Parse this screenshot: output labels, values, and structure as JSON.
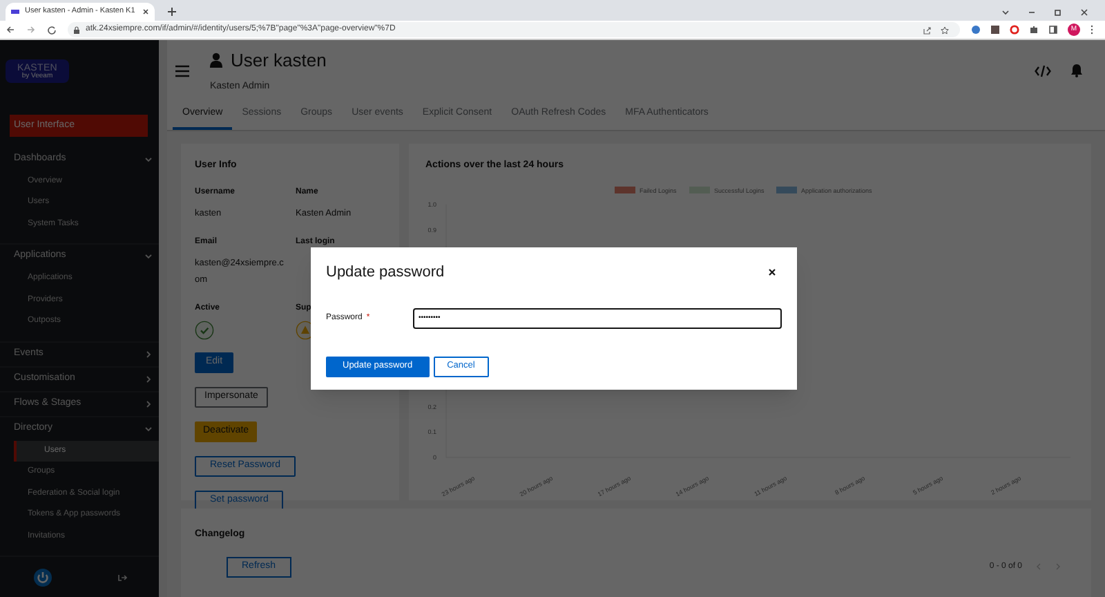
{
  "browser": {
    "tab_title": "User kasten - Admin - Kasten K1",
    "url": "atk.24xsiempre.com/if/admin/#/identity/users/5;%7B\"page\"%3A\"page-overview\"%7D",
    "profile_initial": "M"
  },
  "sidebar": {
    "logo": {
      "name": "KASTEN",
      "tagline": "by Veeam"
    },
    "interface_link": "User Interface",
    "sections": [
      {
        "label": "Dashboards",
        "expanded": true,
        "items": [
          {
            "label": "Overview",
            "selected": false
          },
          {
            "label": "Users",
            "selected": false
          },
          {
            "label": "System Tasks",
            "selected": false
          }
        ]
      },
      {
        "label": "Applications",
        "expanded": true,
        "items": [
          {
            "label": "Applications",
            "selected": false
          },
          {
            "label": "Providers",
            "selected": false
          },
          {
            "label": "Outposts",
            "selected": false
          }
        ]
      },
      {
        "label": "Events",
        "expanded": false
      },
      {
        "label": "Customisation",
        "expanded": false
      },
      {
        "label": "Flows & Stages",
        "expanded": false
      },
      {
        "label": "Directory",
        "expanded": true,
        "items": [
          {
            "label": "Users",
            "selected": true
          },
          {
            "label": "Groups",
            "selected": false
          },
          {
            "label": "Federation & Social login",
            "selected": false
          },
          {
            "label": "Tokens & App passwords",
            "selected": false
          },
          {
            "label": "Invitations",
            "selected": false
          }
        ]
      }
    ]
  },
  "header": {
    "title": "User kasten",
    "subtitle": "Kasten Admin"
  },
  "tabs": [
    {
      "label": "Overview",
      "selected": true
    },
    {
      "label": "Sessions",
      "selected": false
    },
    {
      "label": "Groups",
      "selected": false
    },
    {
      "label": "User events",
      "selected": false
    },
    {
      "label": "Explicit Consent",
      "selected": false
    },
    {
      "label": "OAuth Refresh Codes",
      "selected": false
    },
    {
      "label": "MFA Authenticators",
      "selected": false
    }
  ],
  "user_info": {
    "title": "User Info",
    "fields": [
      {
        "label": "Username",
        "value": "kasten"
      },
      {
        "label": "Name",
        "value": "Kasten Admin"
      },
      {
        "label": "Email",
        "value": "kasten@24xsiempre.com"
      },
      {
        "label": "Last login"
      }
    ],
    "statuses": [
      {
        "label": "Active",
        "on": true
      },
      {
        "label": "Sup",
        "on": false
      }
    ],
    "buttons": [
      {
        "label": "Edit",
        "kind": "primary"
      },
      {
        "label": "Impersonate",
        "kind": "secondary"
      },
      {
        "label": "Deactivate",
        "kind": "warning"
      },
      {
        "label": "Reset Password",
        "kind": "outline"
      },
      {
        "label": "Set password",
        "kind": "outline"
      }
    ]
  },
  "actions_chart": {
    "title": "Actions over the last 24 hours",
    "chart_data": {
      "type": "bar",
      "categories": [
        "23 hours ago",
        "20 hours ago",
        "17 hours ago",
        "14 hours ago",
        "11 hours ago",
        "8 hours ago",
        "5 hours ago",
        "2 hours ago"
      ],
      "series": [
        {
          "name": "Failed Logins",
          "color": "#e8826f",
          "values": [
            0,
            0,
            0,
            0,
            0,
            0,
            0,
            0
          ]
        },
        {
          "name": "Successful Logins",
          "color": "#cfe8cf",
          "values": [
            0,
            0,
            0,
            0,
            0,
            0,
            0,
            0
          ]
        },
        {
          "name": "Application authorizations",
          "color": "#86b8e3",
          "values": [
            0,
            0,
            0,
            0,
            0,
            0,
            0,
            0
          ]
        }
      ],
      "ylim": [
        0,
        1
      ],
      "yticks": [
        {
          "value": 0,
          "label": "0"
        },
        {
          "value": 0.1,
          "label": "0.1"
        },
        {
          "value": 0.2,
          "label": "0.2"
        },
        {
          "value": 0.9,
          "label": "0.9"
        },
        {
          "value": 1,
          "label": "1.0"
        }
      ]
    }
  },
  "changelog": {
    "title": "Changelog",
    "refresh": "Refresh",
    "pagination": "0 - 0 of 0"
  },
  "modal": {
    "title": "Update password",
    "field_label": "Password",
    "required_mark": "*",
    "value": "•••••••••",
    "submit": "Update password",
    "cancel": "Cancel"
  }
}
